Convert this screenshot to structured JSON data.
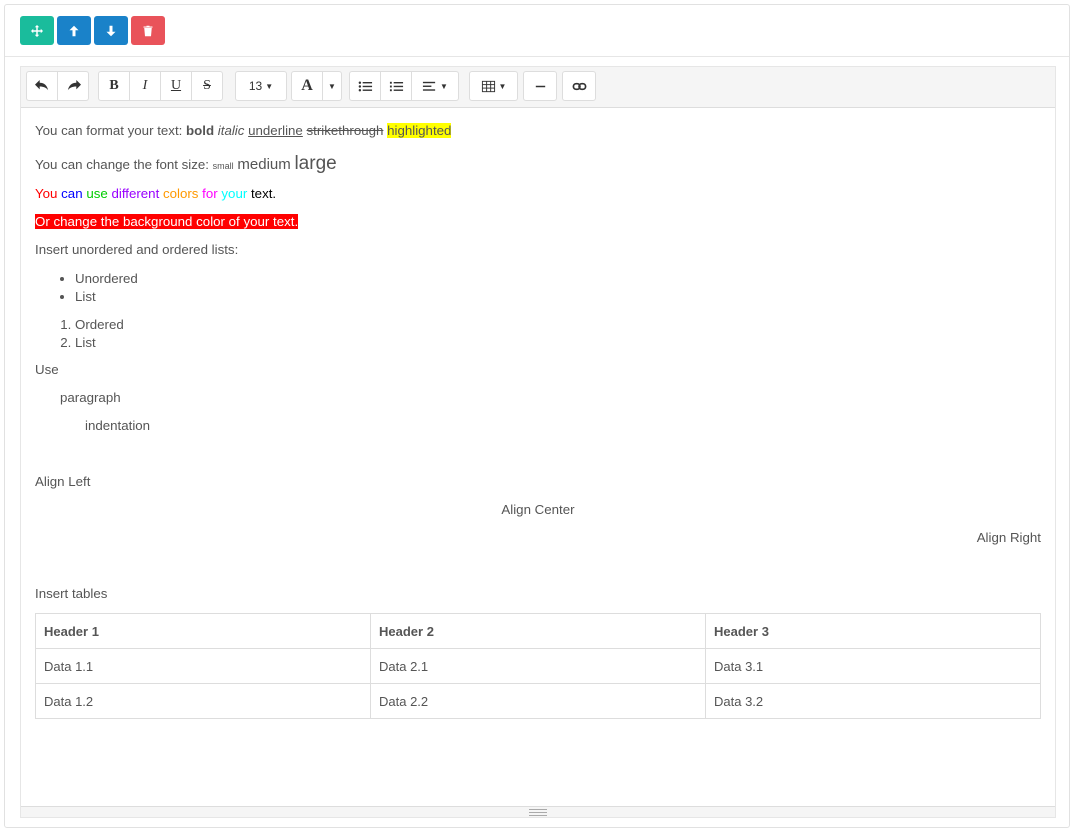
{
  "toolbar": {
    "font_size": "13"
  },
  "content": {
    "format_prefix": "You can format your text: ",
    "bold": "bold",
    "italic": "italic",
    "underline": "underline",
    "strike": "strikethrough",
    "highlight": "highlighted",
    "size_prefix": "You can change the font size: ",
    "small": "small",
    "medium": "medium",
    "large": "large",
    "colors": [
      {
        "text": "You",
        "color": "#ff0000"
      },
      {
        "text": "can",
        "color": "#0000ff"
      },
      {
        "text": "use",
        "color": "#00cc00"
      },
      {
        "text": "different",
        "color": "#9900ff"
      },
      {
        "text": "colors",
        "color": "#ff9900"
      },
      {
        "text": "for",
        "color": "#ff00ff"
      },
      {
        "text": "your",
        "color": "#00ffff"
      },
      {
        "text": "text.",
        "color": "#000000"
      }
    ],
    "bg_text": "Or change the background color of your text.",
    "lists_intro": "Insert unordered and ordered lists:",
    "unordered": [
      "Unordered",
      "List"
    ],
    "ordered": [
      "Ordered",
      "List"
    ],
    "use": "Use",
    "paragraph": "paragraph",
    "indentation": "indentation",
    "align_left": "Align Left",
    "align_center": "Align Center",
    "align_right": "Align Right",
    "tables_intro": "Insert tables",
    "table": {
      "headers": [
        "Header 1",
        "Header 2",
        "Header 3"
      ],
      "rows": [
        [
          "Data 1.1",
          "Data 2.1",
          "Data 3.1"
        ],
        [
          "Data 1.2",
          "Data 2.2",
          "Data 3.2"
        ]
      ]
    }
  }
}
